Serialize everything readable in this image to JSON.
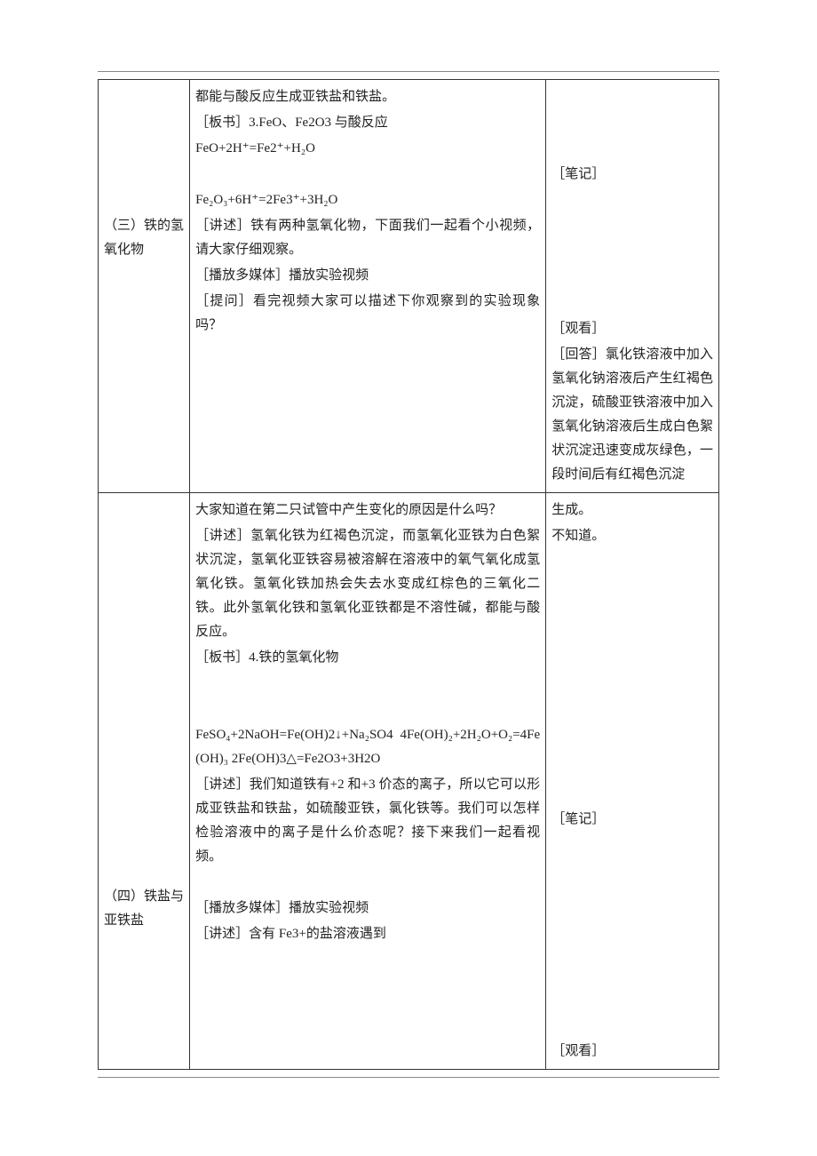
{
  "rows": [
    {
      "col1": "\n\n\n\n\n（三）铁的氢氧化物",
      "col2": "都能与酸反应生成亚铁盐和铁盐。\n［板书］3.FeO、Fe2O3 与酸反应\nFeO+2H⁺=Fe2⁺+H₂O\n\nFe₂O₃+6H⁺=2Fe3⁺+3H₂O\n［讲述］铁有两种氢氧化物，下面我们一起看个小视频，请大家仔细观察。\n［播放多媒体］播放实验视频\n［提问］看完视频大家可以描述下你观察到的实验现象吗？",
      "col3": "\n\n\n［笔记］\n\n\n\n\n\n［观看］\n［回答］氯化铁溶液中加入氢氧化钠溶液后产生红褐色沉淀，硫酸亚铁溶液中加入氢氧化钠溶液后生成白色絮状沉淀迅速变成灰绿色，一段时间后有红褐色沉淀"
    },
    {
      "col1": "\n\n\n\n\n\n\n\n\n\n\n\n\n\n\n（四）铁盐与亚铁盐",
      "col2": "大家知道在第二只试管中产生变化的原因是什么吗？\n［讲述］氢氧化铁为红褐色沉淀，而氢氧化亚铁为白色絮状沉淀，氢氧化亚铁容易被溶解在溶液中的氧气氧化成氢氧化铁。氢氧化铁加热会失去水变成红棕色的三氧化二铁。此外氢氧化铁和氢氧化亚铁都是不溶性碱，都能与酸反应。\n［板书］4.铁的氢氧化物\n\n\nFeSO₄+2NaOH=Fe(OH)2↓+Na₂SO4 4Fe(OH)₂+2H₂O+O₂=4Fe(OH)₃ 2Fe(OH)3△=Fe2O3+3H2O\n［讲述］我们知道铁有+2 和+3 价态的离子，所以它可以形成亚铁盐和铁盐，如硫酸亚铁，氯化铁等。我们可以怎样检验溶液中的离子是什么价态呢？接下来我们一起看视频。\n\n［播放多媒体］播放实验视频\n［讲述］含有 Fe3+的盐溶液遇到",
      "col3": "生成。\n不知道。\n\n\n\n\n\n\n\n\n\n\n［笔记］\n\n\n\n\n\n\n\n\n［观看］"
    }
  ]
}
